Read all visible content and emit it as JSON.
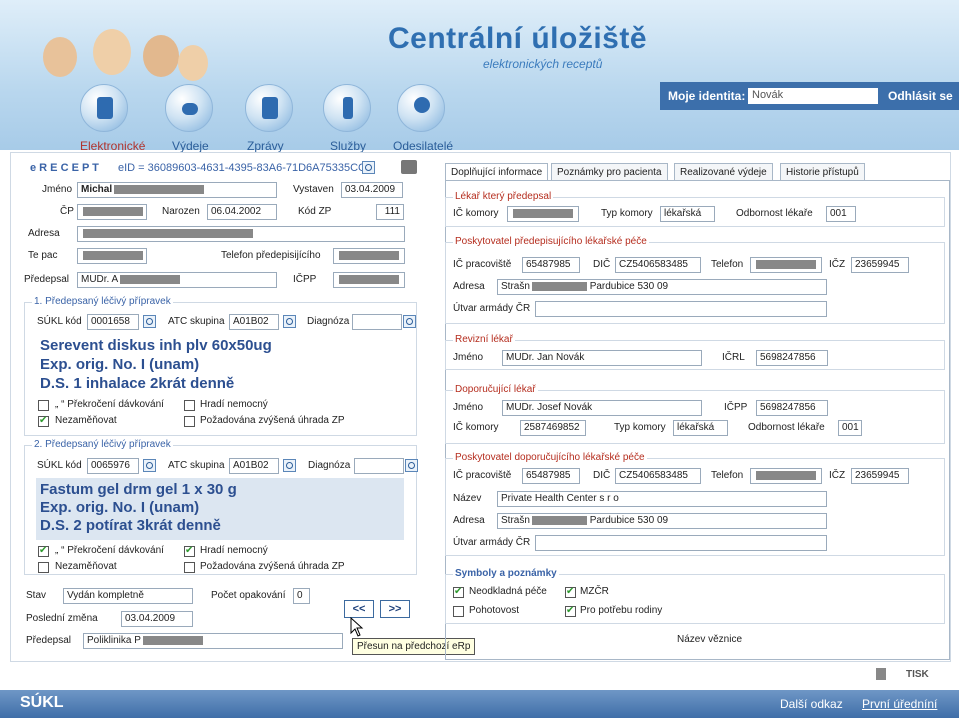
{
  "header": {
    "title": "Centrální úložiště",
    "subtitle": "elektronických receptů",
    "identity_label": "Moje identita:",
    "identity_value": "Novák",
    "logout": "Odhlásit se"
  },
  "nav": [
    {
      "label": "Elektronické",
      "icon": "prescription-icon",
      "active": true
    },
    {
      "label": "Výdeje",
      "icon": "pills-icon"
    },
    {
      "label": "Zprávy",
      "icon": "document-icon"
    },
    {
      "label": "Služby",
      "icon": "microscope-icon"
    },
    {
      "label": "Odesilatelé",
      "icon": "doctor-icon"
    }
  ],
  "prescription": {
    "title": "e R E C E P T",
    "eid": "eID = 36089603-4631-4395-83A6-71D6A75335CC",
    "jmeno_label": "Jméno",
    "jmeno_value": "Michal",
    "vystaven_label": "Vystaven",
    "vystaven_value": "03.04.2009",
    "cp_label": "ČP",
    "narozen_label": "Narozen",
    "narozen_value": "06.04.2002",
    "kodzp_label": "Kód ZP",
    "kodzp_value": "111",
    "adresa_label": "Adresa",
    "tel_label": "Te  pac",
    "tel_pred_label": "Telefon předepisijícího",
    "predepsal_label": "Předepsal",
    "predepsal_value": "MUDr. A",
    "icpp_label": "IČPP"
  },
  "drug1": {
    "header": "1. Předepsaný léčivý přípravek",
    "sukl_label": "SÚKL kód",
    "sukl_value": "0001658",
    "atc_label": "ATC skupina",
    "atc_value": "A01B02",
    "diag_label": "Diagnóza",
    "line1": "Serevent diskus inh plv 60x50ug",
    "line2": "Exp. orig. No. I (unam)",
    "line3": "D.S. 1 inhalace 2krát denně",
    "chk1": "„ “ Překročení dávkování",
    "chk2": "Hradí nemocný",
    "chk3": "Nezaměňovat",
    "chk4": "Požadována zvýšená úhrada ZP"
  },
  "drug2": {
    "header": "2. Předepsaný léčivý přípravek",
    "sukl_label": "SÚKL kód",
    "sukl_value": "0065976",
    "atc_label": "ATC skupina",
    "atc_value": "A01B02",
    "diag_label": "Diagnóza",
    "line1": "Fastum gel   drm gel   1 x 30 g",
    "line2": "Exp. orig. No. I (unam)",
    "line3": "D.S. 2 potírat 3krát denně",
    "chk1": "„ “ Překročení dávkování",
    "chk2": "Hradí nemocný",
    "chk3": "Nezaměňovat",
    "chk4": "Požadována zvýšená úhrada ZP"
  },
  "bottom": {
    "stav_label": "Stav",
    "stav_value": "Vydán kompletně",
    "pocet_label": "Počet opakování",
    "pocet_value": "0",
    "posledni_label": "Poslední změna",
    "posledni_value": "03.04.2009",
    "predepsal_label": "Předepsal",
    "predepsal_value": "Poliklinika P",
    "prev": "<<",
    "next": ">>",
    "tooltip": "Přesun na předchozí eRp",
    "nazev_label": "Název věznice"
  },
  "tabs": [
    "Doplňující informace",
    "Poznámky pro pacienta",
    "Realizované výdeje",
    "Historie přístupů"
  ],
  "right": {
    "lekar_sect": "Lékař který předepsal",
    "ic_komory": "IČ komory",
    "typ_komory": "Typ komory",
    "typ_value": "lékařská",
    "odbornost": "Odbornost lékaře",
    "odbornost_value": "001",
    "posk_sect": "Poskytovatel předepisujícího lékařské péče",
    "ic_prac": "IČ pracoviště",
    "ic_prac_value": "65487985",
    "dic": "DIČ",
    "dic_value": "CZ5406583485",
    "telefon": "Telefon",
    "icz": "IČZ",
    "icz_value": "23659945",
    "adresa": "Adresa",
    "adresa_value": "Strašn",
    "adresa_tail": "Pardubice 530 09",
    "utvar": "Útvar armády ČR",
    "revizni_sect": "Revizní lékař",
    "jmeno": "Jméno",
    "rev_jmeno": "MUDr. Jan Novák",
    "icrl": "IČRL",
    "icrl_value": "5698247856",
    "dopor_sect": "Doporučující lékař",
    "dopor_jmeno": "MUDr. Josef Novák",
    "icpp": "IČPP",
    "icpp_value": "5698247856",
    "dopor_ic_value": "2587469852",
    "posk2_sect": "Poskytovatel doporučujícího lékařské péče",
    "nazev": "Název",
    "nazev_value": "Private Health Center s r o",
    "symboly_sect": "Symboly a poznámky",
    "sym1": "Neodkladná péče",
    "sym2": "MZČR",
    "sym3": "Pohotovost",
    "sym4": "Pro potřebu rodiny"
  },
  "footer": {
    "logo": "SÚKL",
    "tisk": "TISK",
    "next": "Další odkaz",
    "login": "První úředníní"
  }
}
